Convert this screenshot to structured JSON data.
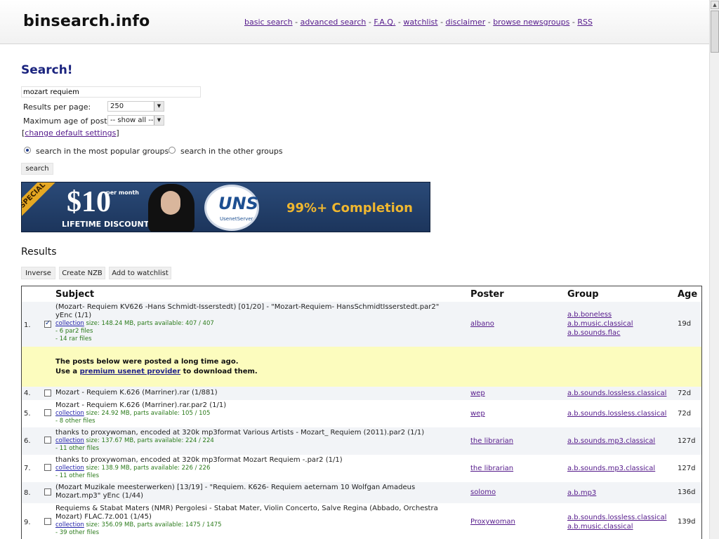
{
  "header": {
    "logo": "binsearch.info",
    "nav": [
      "basic search",
      "advanced search",
      "F.A.Q.",
      "watchlist",
      "disclaimer",
      "browse newsgroups",
      "RSS"
    ]
  },
  "search": {
    "title": "Search!",
    "query": "mozart requiem",
    "results_per_page_label": "Results per page:",
    "results_per_page_value": "250",
    "max_age_label": "Maximum age of post:",
    "max_age_value": "-- show all --",
    "change_settings_open": "[",
    "change_settings": "change default settings",
    "change_settings_close": "]",
    "radio_popular": "search in the most popular groups",
    "radio_other": "search in the other groups",
    "radio_selected": "popular",
    "search_button": "search"
  },
  "banner": {
    "ribbon": "SPECIAL",
    "price": "$10",
    "per_month": "per month",
    "lifetime": "LIFETIME DISCOUNT",
    "logo_text": "UNS",
    "logo_sub": "UsenetServer",
    "completion": "99%+ Completion"
  },
  "results": {
    "title": "Results",
    "buttons": {
      "inverse": "Inverse",
      "create_nzb": "Create NZB",
      "watchlist": "Add to watchlist"
    },
    "columns": {
      "subject": "Subject",
      "poster": "Poster",
      "group": "Group",
      "age": "Age"
    },
    "notice": {
      "line1": "The posts below were posted a long time ago.",
      "line2_prefix": "Use a ",
      "line2_link": "premium usenet provider",
      "line2_suffix": " to download them."
    },
    "rows": [
      {
        "num": "1.",
        "checked": true,
        "subject1": "(Mozart- Requiem KV626 -Hans Schmidt-Isserstedt) [01/20] - \"Mozart-Requiem- HansSchmidtIsserstedt.par2\"",
        "subject2": "yEnc (1/1)",
        "link": "collection",
        "size": " size: 148.24 MB, parts available: 407 / 407",
        "extra1": "- 6 par2 files",
        "extra2": "- 14 rar files",
        "poster": "albano",
        "groups": [
          "a.b.boneless",
          "a.b.music.classical",
          "a.b.sounds.flac"
        ],
        "age": "19d"
      },
      {
        "num": "4.",
        "checked": false,
        "subject1": "Mozart - Requiem K.626 (Marriner).rar (1/881)",
        "poster": "wep",
        "groups": [
          "a.b.sounds.lossless.classical"
        ],
        "age": "72d"
      },
      {
        "num": "5.",
        "checked": false,
        "subject1": "Mozart - Requiem K.626 (Marriner).rar.par2 (1/1)",
        "link": "collection",
        "size": " size: 24.92 MB, parts available: 105 / 105",
        "extra1": "- 8 other files",
        "poster": "wep",
        "groups": [
          "a.b.sounds.lossless.classical"
        ],
        "age": "72d"
      },
      {
        "num": "6.",
        "checked": false,
        "subject1": "thanks to proxywoman, encoded at 320k mp3format Various Artists - Mozart_ Requiem (2011).par2 (1/1)",
        "link": "collection",
        "size": " size: 137.67 MB, parts available: 224 / 224",
        "extra1": "- 11 other files",
        "poster": "the librarian",
        "groups": [
          "a.b.sounds.mp3.classical"
        ],
        "age": "127d"
      },
      {
        "num": "7.",
        "checked": false,
        "subject1": "thanks to proxywoman, encoded at 320k mp3format Mozart Requiem -.par2 (1/1)",
        "link": "collection",
        "size": " size: 138.9 MB, parts available: 226 / 226",
        "extra1": "- 11 other files",
        "poster": "the librarian",
        "groups": [
          "a.b.sounds.mp3.classical"
        ],
        "age": "127d"
      },
      {
        "num": "8.",
        "checked": false,
        "subject1": "(Mozart Muzikale meesterwerken) [13/19] - \"Requiem. K626- Requiem aeternam 10 Wolfgan Amadeus",
        "subject2": "Mozart.mp3\" yEnc (1/44)",
        "poster": "solomo",
        "groups": [
          "a.b.mp3"
        ],
        "age": "136d"
      },
      {
        "num": "9.",
        "checked": false,
        "subject1": "Requiems & Stabat Maters (NMR) Pergolesi - Stabat Mater, Violin Concerto, Salve Regina (Abbado, Orchestra",
        "subject2": "Mozart) FLAC.7z.001 (1/45)",
        "link": "collection",
        "size": " size: 356.09 MB, parts available: 1475 / 1475",
        "extra1": "- 39 other files",
        "poster": "Proxywoman",
        "groups": [
          "a.b.sounds.lossless.classical",
          "a.b.music.classical"
        ],
        "age": "139d"
      }
    ]
  }
}
